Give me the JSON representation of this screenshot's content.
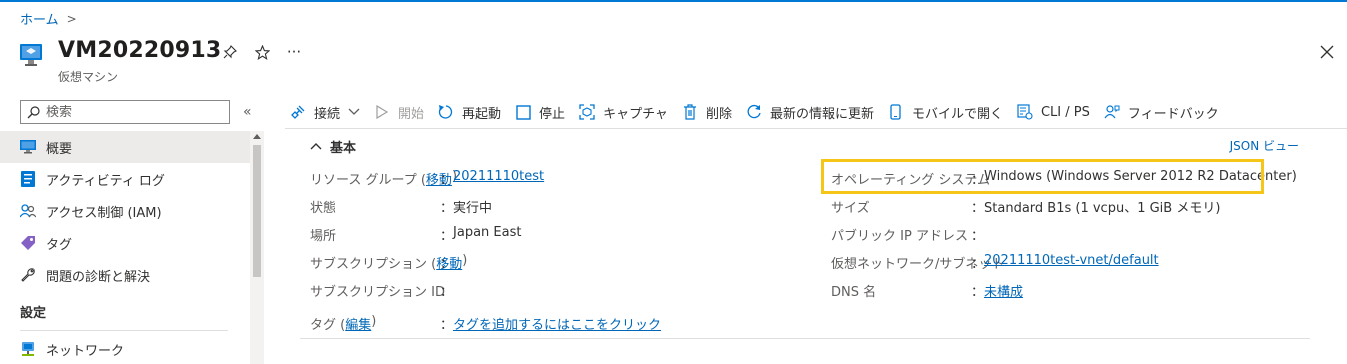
{
  "breadcrumb": {
    "home": "ホーム",
    "separator": ">"
  },
  "header": {
    "title": "VM20220913",
    "subtitle": "仮想マシン",
    "more": "···"
  },
  "sidebar": {
    "search_placeholder": "検索",
    "collapse": "«",
    "items": [
      {
        "label": "概要",
        "icon": "monitor-icon",
        "active": true
      },
      {
        "label": "アクティビティ ログ",
        "icon": "activity-log-icon"
      },
      {
        "label": "アクセス制御 (IAM)",
        "icon": "people-icon"
      },
      {
        "label": "タグ",
        "icon": "tag-icon"
      },
      {
        "label": "問題の診断と解決",
        "icon": "wrench-icon"
      }
    ],
    "section": "設定",
    "section_items": [
      {
        "label": "ネットワーク",
        "icon": "network-icon"
      }
    ]
  },
  "toolbar": {
    "connect": "接続",
    "start": "開始",
    "restart": "再起動",
    "stop": "停止",
    "capture": "キャプチャ",
    "delete": "削除",
    "refresh": "最新の情報に更新",
    "mobile": "モバイルで開く",
    "cli": "CLI / PS",
    "feedback": "フィードバック"
  },
  "essentials": {
    "header": "基本",
    "json_view": "JSON ビュー",
    "left": {
      "resource_group_label": "リソース グループ (",
      "resource_group_move": "移動",
      "resource_group_label_end": ")",
      "resource_group_value": "20211110test",
      "status_label": "状態",
      "status_value": "実行中",
      "location_label": "場所",
      "location_value": "Japan East",
      "subscription_label": "サブスクリプション (",
      "subscription_move": "移動",
      "subscription_label_end": ")",
      "subscription_id_label": "サブスクリプション ID",
      "tags_label": "タグ (",
      "tags_edit": "編集",
      "tags_label_end": ")",
      "tags_value": "タグを追加するにはここをクリック"
    },
    "right": {
      "os_label": "オペレーティング システム",
      "os_value": "Windows (Windows Server 2012 R2 Datacenter)",
      "size_label": "サイズ",
      "size_value": "Standard B1s (1 vcpu、1 GiB メモリ)",
      "public_ip_label": "パブリック IP アドレス",
      "public_ip_value": "",
      "vnet_label": "仮想ネットワーク/サブネット",
      "vnet_value": "20211110test-vnet/default",
      "dns_label": "DNS 名",
      "dns_value": "未構成"
    },
    "colon": "："
  },
  "colors": {
    "accent": "#0078d4",
    "link": "#0067b8",
    "highlight": "#f5c518"
  }
}
